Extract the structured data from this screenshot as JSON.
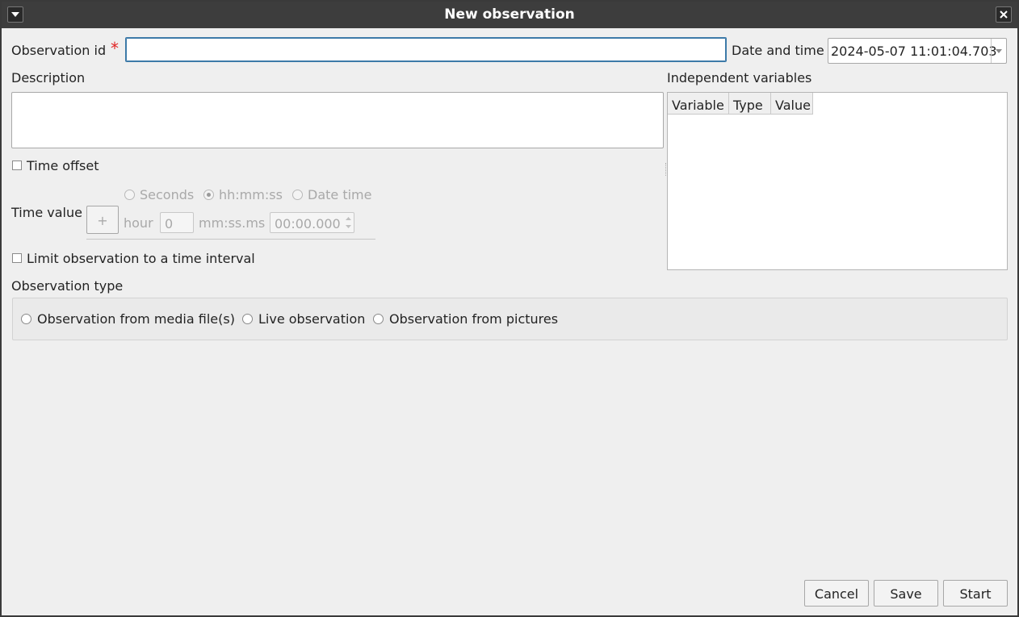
{
  "window": {
    "title": "New observation",
    "menu_icon": "chevron-down-icon",
    "close_icon": "close-icon"
  },
  "form": {
    "obs_id_label": "Observation id",
    "required_marker": "*",
    "obs_id_value": "",
    "date_time_label": "Date and time",
    "date_time_value": "2024-05-07 11:01:04.703",
    "description_label": "Description",
    "description_value": "",
    "time_offset_label": "Time offset",
    "time_value_label": "Time value",
    "time_format_options": [
      "Seconds",
      "hh:mm:ss",
      "Date time"
    ],
    "time_format_selected": "hh:mm:ss",
    "sign_button": "+",
    "hour_label": "hour",
    "hour_value": "0",
    "mmss_label": "mm:ss.ms",
    "mmss_value": "00:00.000",
    "limit_label": "Limit observation to a time interval",
    "obs_type_label": "Observation type",
    "obs_type_options": [
      "Observation from media file(s)",
      "Live observation",
      "Observation from pictures"
    ]
  },
  "independent_variables": {
    "label": "Independent variables",
    "columns": [
      "Variable",
      "Type",
      "Value"
    ],
    "rows": []
  },
  "buttons": {
    "cancel": "Cancel",
    "save": "Save",
    "start": "Start"
  },
  "colors": {
    "titlebar": "#3d3d3d",
    "background": "#efefef",
    "required": "#e12525",
    "focus": "#3d7aa8"
  }
}
